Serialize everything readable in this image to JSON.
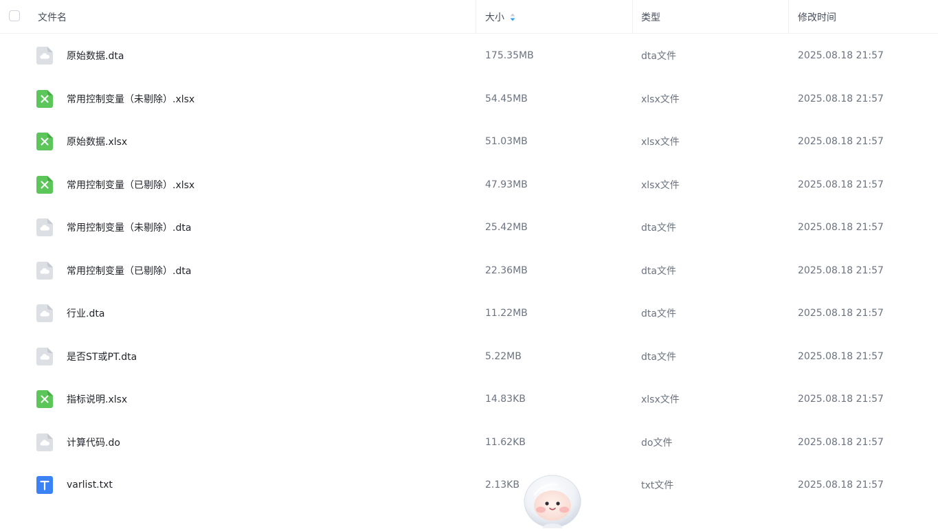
{
  "header": {
    "name": "文件名",
    "size": "大小",
    "type": "类型",
    "modified": "修改时间"
  },
  "files": [
    {
      "name": "原始数据.dta",
      "size": "175.35MB",
      "type": "dta文件",
      "modified": "2025.08.18 21:57",
      "icon": "cloud-file-icon"
    },
    {
      "name": "常用控制变量（未剔除）.xlsx",
      "size": "54.45MB",
      "type": "xlsx文件",
      "modified": "2025.08.18 21:57",
      "icon": "excel-file-icon"
    },
    {
      "name": "原始数据.xlsx",
      "size": "51.03MB",
      "type": "xlsx文件",
      "modified": "2025.08.18 21:57",
      "icon": "excel-file-icon"
    },
    {
      "name": "常用控制变量（已剔除）.xlsx",
      "size": "47.93MB",
      "type": "xlsx文件",
      "modified": "2025.08.18 21:57",
      "icon": "excel-file-icon"
    },
    {
      "name": "常用控制变量（未剔除）.dta",
      "size": "25.42MB",
      "type": "dta文件",
      "modified": "2025.08.18 21:57",
      "icon": "cloud-file-icon"
    },
    {
      "name": "常用控制变量（已剔除）.dta",
      "size": "22.36MB",
      "type": "dta文件",
      "modified": "2025.08.18 21:57",
      "icon": "cloud-file-icon"
    },
    {
      "name": "行业.dta",
      "size": "11.22MB",
      "type": "dta文件",
      "modified": "2025.08.18 21:57",
      "icon": "cloud-file-icon"
    },
    {
      "name": "是否ST或PT.dta",
      "size": "5.22MB",
      "type": "dta文件",
      "modified": "2025.08.18 21:57",
      "icon": "cloud-file-icon"
    },
    {
      "name": "指标说明.xlsx",
      "size": "14.83KB",
      "type": "xlsx文件",
      "modified": "2025.08.18 21:57",
      "icon": "excel-file-icon"
    },
    {
      "name": "计算代码.do",
      "size": "11.62KB",
      "type": "do文件",
      "modified": "2025.08.18 21:57",
      "icon": "cloud-file-icon"
    },
    {
      "name": "varlist.txt",
      "size": "2.13KB",
      "type": "txt文件",
      "modified": "2025.08.18 21:57",
      "icon": "text-file-icon"
    }
  ],
  "colors": {
    "excel": "#5cc65a",
    "text": "#3b82f6",
    "generic": "#dcdfe4",
    "accent": "#2aa0f5"
  }
}
